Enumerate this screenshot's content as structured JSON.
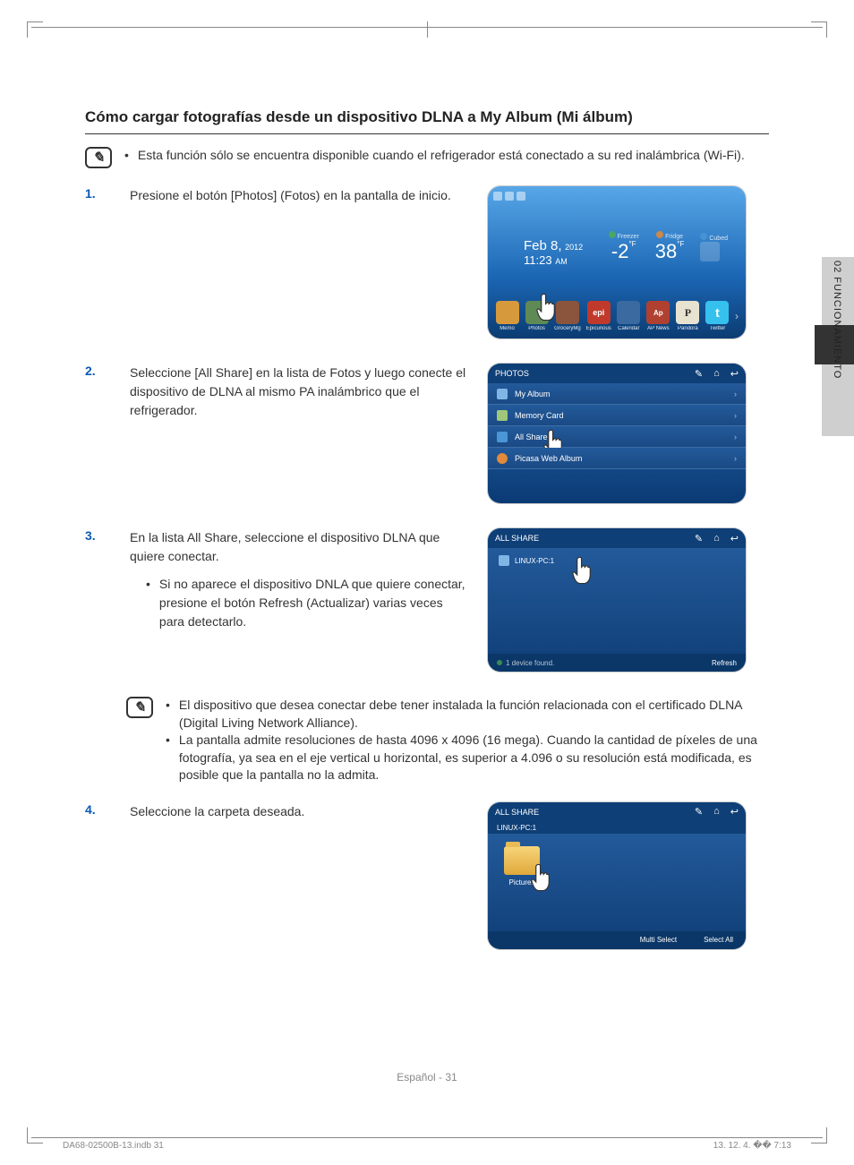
{
  "header": {
    "title": "Cómo cargar fotografías desde un dispositivo DLNA a My Album (Mi álbum)"
  },
  "sideTab": {
    "label": "02  FUNCIONAMIENTO"
  },
  "note1": {
    "text": "Esta función sólo se encuentra disponible cuando el refrigerador está conectado a su red inalámbrica (Wi-Fi)."
  },
  "steps": {
    "s1": {
      "num": "1.",
      "text": "Presione el botón [Photos] (Fotos) en la pantalla de inicio."
    },
    "s2": {
      "num": "2.",
      "text": "Seleccione [All Share] en la lista de Fotos y luego conecte el dispositivo de DLNA al mismo PA inalámbrico que el refrigerador."
    },
    "s3": {
      "num": "3.",
      "text": "En la lista All Share, seleccione el dispositivo DLNA que quiere conectar.",
      "sub": "Si no aparece el dispositivo DNLA que quiere conectar, presione el botón Refresh (Actualizar) varias veces para detectarlo."
    },
    "s4": {
      "num": "4.",
      "text": "Seleccione la carpeta deseada."
    }
  },
  "note2": {
    "a": "El dispositivo que desea conectar debe tener instalada la función relacionada con el certificado DLNA (Digital Living Network Alliance).",
    "b": "La pantalla admite resoluciones de hasta 4096 x 4096 (16 mega). Cuando la cantidad de píxeles de una fotografía, ya sea en el eje vertical u horizontal, es superior a 4.096 o su resolución está modificada, es posible que la pantalla no la admita."
  },
  "shot1": {
    "date": "Feb 8,",
    "year": "2012",
    "time": "11:23",
    "ampm": "AM",
    "freezer": {
      "label": "Freezer",
      "value": "-2",
      "unit": "°F"
    },
    "fridge": {
      "label": "Fridge",
      "value": "38",
      "unit": "°F"
    },
    "cubed": {
      "label": "Cubed"
    },
    "apps": {
      "a0": "Memo",
      "a1": "Photos",
      "a2": "GroceryMg",
      "a3": "Epicurious",
      "a4": "Calendar",
      "a5": "AP News",
      "a6": "Pandora",
      "a7": "Twitter"
    }
  },
  "shot2": {
    "title": "PHOTOS",
    "items": {
      "i0": "My Album",
      "i1": "Memory Card",
      "i2": "All Share",
      "i3": "Picasa Web Album"
    }
  },
  "shot3": {
    "title": "ALL SHARE",
    "device": "LINUX-PC:1",
    "found": "1 device found.",
    "refresh": "Refresh"
  },
  "shot4": {
    "title": "ALL SHARE",
    "crumb": "LINUX-PC:1",
    "folder": "Pictures",
    "multi": "Multi Select",
    "selectAll": "Select All"
  },
  "pageNum": "Español - 31",
  "meta": {
    "left": "DA68-02500B-13.indb   31",
    "right": "13. 12. 4.   �� 7:13"
  }
}
